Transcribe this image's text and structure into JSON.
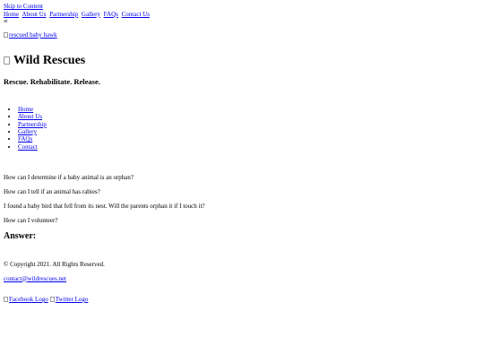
{
  "skip_link": "Skip to Content",
  "top_nav": [
    "Home",
    "About Us",
    "Partnership",
    "Gallery",
    "FAQs",
    "Contact Us"
  ],
  "menu_icon": "hamburger-icon",
  "hero_image_alt": "rescued baby hawk",
  "site": {
    "title": "Wild Rescues",
    "tagline": "Rescue. Rehabilitate. Release."
  },
  "main_nav": [
    "Home",
    "About Us",
    "Partnership",
    "Gallery",
    "FAQs",
    "Contact"
  ],
  "faqs": [
    "How can I determine if a baby animal is an orphan?",
    "How can I tell if an animal has rabies?",
    "I found a baby bird that fell from its nest. Will the parents orphan it if I touch it?",
    "How can I volunteer?"
  ],
  "answer_heading": "Answer:",
  "footer": {
    "copyright": "© Copyright 2021. All Rights Reserved.",
    "email": "contact@wildrescues.net",
    "facebook_alt": "Facebook Logo",
    "twitter_alt": "Twitter Logo"
  },
  "colors": {
    "link": "#0000ee",
    "text": "#000000",
    "background": "#ffffff"
  }
}
